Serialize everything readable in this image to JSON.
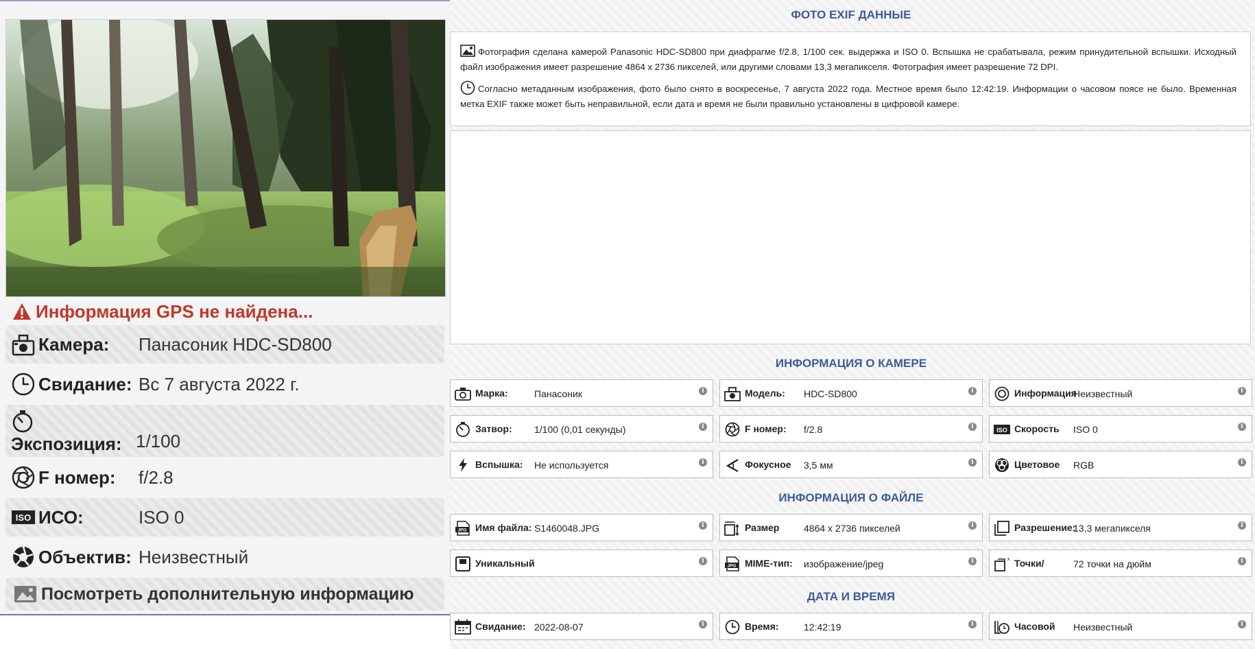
{
  "left": {
    "gps_warning": "Информация GPS не найдена...",
    "rows": [
      {
        "label": "Камера:",
        "value": "Панасоник HDC-SD800",
        "icon": "camera-icon"
      },
      {
        "label": "Свидание:",
        "value": "Вс 7 августа 2022 г.",
        "icon": "clock-icon"
      },
      {
        "label": "Экспозиция:",
        "value": "1/100",
        "icon": "stopwatch-icon"
      },
      {
        "label": "F номер:",
        "value": "f/2.8",
        "icon": "aperture-icon"
      },
      {
        "label": "ИСО:",
        "value": "ISO 0",
        "icon": "iso-icon"
      },
      {
        "label": "Объектив:",
        "value": "Неизвестный",
        "icon": "lens-icon"
      }
    ],
    "more_link": "Посмотреть дополнительную информацию"
  },
  "right": {
    "title_exif": "ФОТО EXIF ДАННЫЕ",
    "summary_1": "Фотография сделана камерой Panasonic HDC-SD800 при диафрагме f/2.8, 1/100 сек. выдержка и ISO 0. Вспышка не срабатывала, режим принудительной вспышки. Исходный файл изображения имеет разрешение 4864 x 2736 пикселей, или другими словами 13,3 мегапикселя. Фотография имеет разрешение 72 DPI.",
    "summary_2": "Согласно метаданным изображения, фото было снято в воскресенье, 7 августа 2022 года. Местное время было 12:42:19. Информации о часовом поясе не было. Временная метка EXIF также может быть неправильной, если дата и время не были правильно установлены в цифровой камере.",
    "title_camera": "ИНФОРМАЦИЯ О КАМЕРЕ",
    "camera": [
      {
        "label": "Марка:",
        "value": "Панасоник",
        "icon": "camera-make-icon"
      },
      {
        "label": "Модель:",
        "value": "HDC-SD800",
        "icon": "camera-model-icon"
      },
      {
        "label": "Информация об",
        "value": "Неизвестный",
        "icon": "lens-info-icon"
      },
      {
        "label": "Затвор:",
        "value": "1/100 (0,01 секунды)",
        "icon": "shutter-icon"
      },
      {
        "label": "F номер:",
        "value": "f/2.8",
        "icon": "aperture-icon"
      },
      {
        "label": "Скорость ISO:",
        "value": "ISO 0",
        "icon": "iso-icon"
      },
      {
        "label": "Вспышка:",
        "value": "Не используется",
        "icon": "flash-icon"
      },
      {
        "label": "Фокусное",
        "value": "3,5 мм",
        "icon": "focal-length-icon"
      },
      {
        "label": "Цветовое",
        "value": "RGB",
        "icon": "color-space-icon"
      }
    ],
    "title_file": "ИНФОРМАЦИЯ О ФАЙЛЕ",
    "file": [
      {
        "label": "Имя файла:",
        "value": "S1460048.JPG",
        "icon": "jpg-file-icon"
      },
      {
        "label": "Размер изображения:",
        "value": "4864 x 2736 пикселей",
        "icon": "image-size-icon"
      },
      {
        "label": "Разрешение:",
        "value": "13,3 мегапикселя",
        "icon": "resolution-icon"
      },
      {
        "label": "Уникальный",
        "value": "",
        "icon": "unique-id-icon"
      },
      {
        "label": "MIME-тип:",
        "value": "изображение/jpeg",
        "icon": "mime-type-icon"
      },
      {
        "label": "Точки/",
        "value": "72 точки на дюйм",
        "icon": "dpi-icon"
      }
    ],
    "title_datetime": "ДАТА И ВРЕМЯ",
    "datetime": [
      {
        "label": "Свидание:",
        "value": "2022-08-07",
        "icon": "calendar-icon"
      },
      {
        "label": "Время:",
        "value": "12:42:19",
        "icon": "clock-icon"
      },
      {
        "label": "Часовой",
        "value": "Неизвестный",
        "icon": "timezone-icon"
      }
    ],
    "info_glyph": "i"
  }
}
